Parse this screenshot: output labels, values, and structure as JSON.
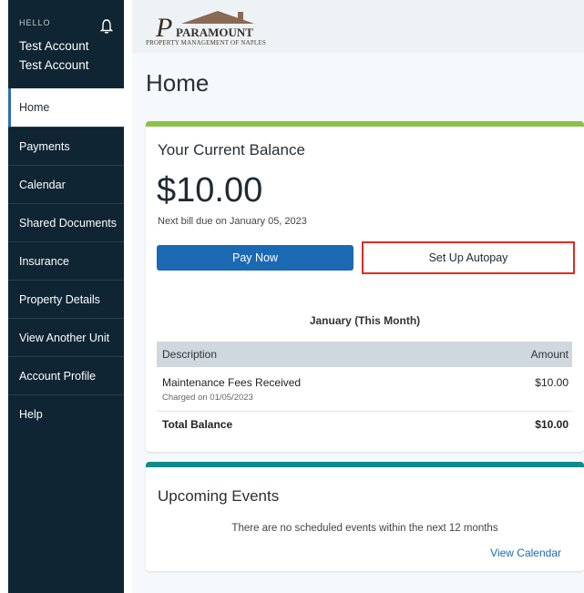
{
  "sidebar": {
    "hello": "HELLO",
    "user_line1": "Test Account",
    "user_line2": "Test Account",
    "bell_icon": "bell-icon",
    "items": [
      {
        "label": "Home",
        "active": true
      },
      {
        "label": "Payments"
      },
      {
        "label": "Calendar"
      },
      {
        "label": "Shared Documents"
      },
      {
        "label": "Insurance"
      },
      {
        "label": "Property Details"
      },
      {
        "label": "View Another Unit"
      },
      {
        "label": "Account Profile"
      },
      {
        "label": "Help"
      }
    ]
  },
  "logo": {
    "name": "PARAMOUNT",
    "subtitle": "PROPERTY MANAGEMENT OF NAPLES"
  },
  "page": {
    "title": "Home"
  },
  "balance": {
    "heading": "Your Current Balance",
    "amount": "$10.00",
    "next_bill": "Next bill due on January 05, 2023",
    "pay_now": "Pay Now",
    "autopay": "Set Up Autopay",
    "month": "January (This Month)",
    "table": {
      "col_description": "Description",
      "col_amount": "Amount",
      "item_desc": "Maintenance Fees Received",
      "item_charged": "Charged on 01/05/2023",
      "item_amount": "$10.00",
      "total_label": "Total Balance",
      "total_amount": "$10.00"
    }
  },
  "events": {
    "heading": "Upcoming Events",
    "message": "There are no scheduled events within the next 12 months",
    "link": "View Calendar"
  },
  "colors": {
    "sidebar_bg": "#0f2533",
    "primary_button": "#1b69b3",
    "balance_accent": "#8bc34a",
    "events_accent": "#0f8b8d",
    "highlight_border": "#e02b20"
  }
}
